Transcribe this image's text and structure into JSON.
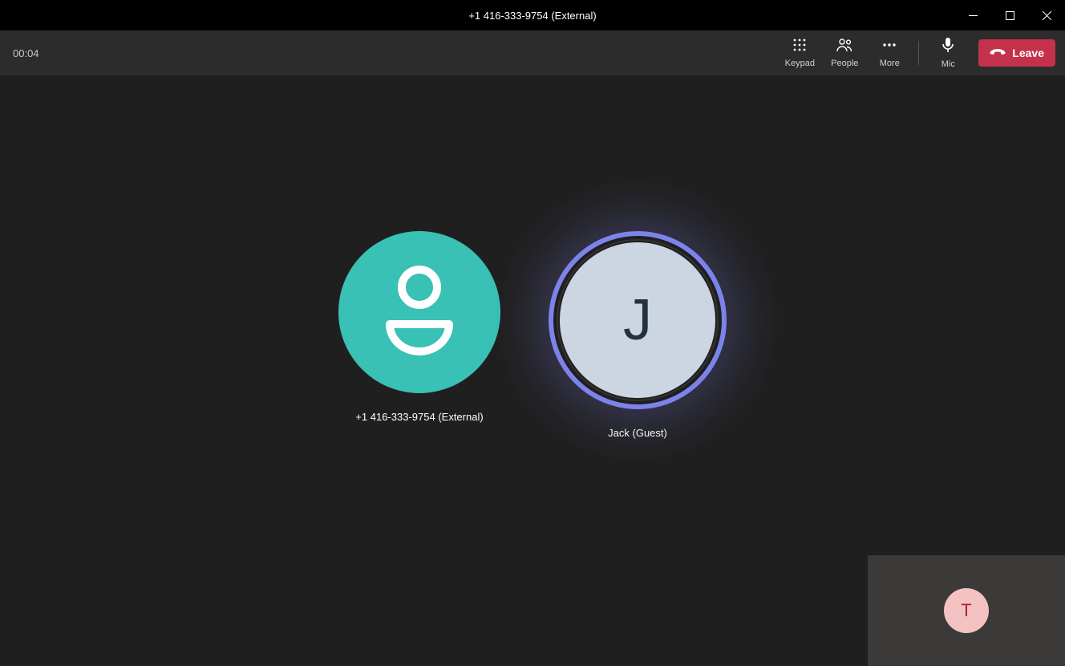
{
  "window": {
    "title": "+1 416-333-9754 (External)"
  },
  "toolbar": {
    "timer": "00:04",
    "keypad_label": "Keypad",
    "people_label": "People",
    "more_label": "More",
    "mic_label": "Mic",
    "leave_label": "Leave"
  },
  "participants": [
    {
      "label": "+1 416-333-9754 (External)"
    },
    {
      "label": "Jack (Guest)",
      "initial": "J"
    }
  ],
  "self": {
    "initial": "T"
  }
}
